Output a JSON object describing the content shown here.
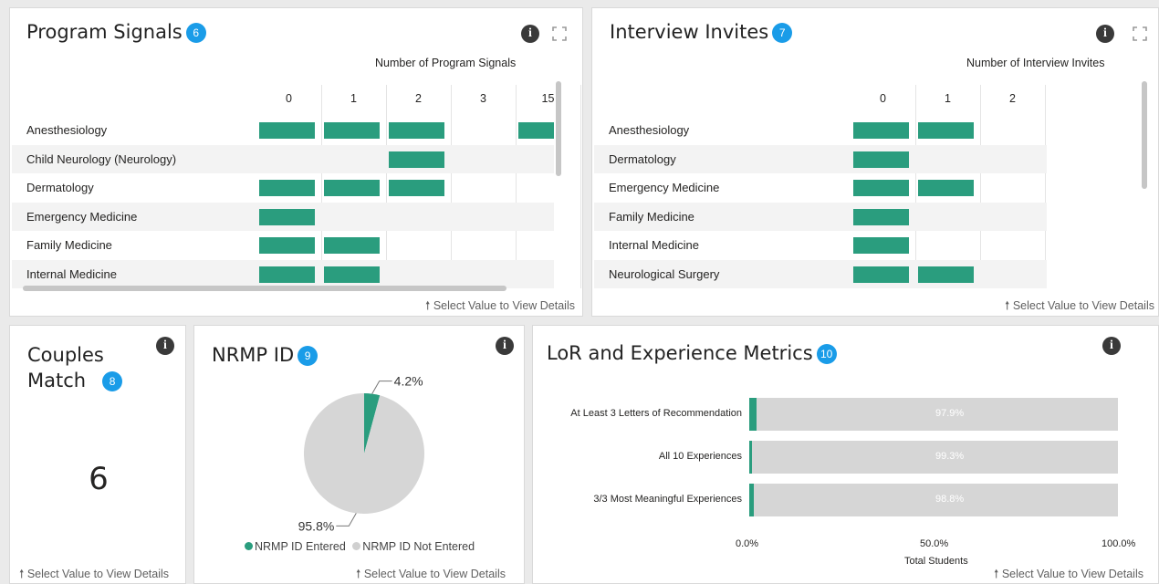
{
  "program_signals": {
    "title": "Program Signals",
    "badge": "6",
    "axis_title": "Number of Program Signals",
    "columns": [
      "0",
      "1",
      "2",
      "3",
      "15"
    ],
    "rows": [
      {
        "label": "Anesthesiology",
        "cells": [
          true,
          true,
          true,
          false,
          true
        ]
      },
      {
        "label": "Child Neurology (Neurology)",
        "cells": [
          false,
          false,
          true,
          false,
          false
        ]
      },
      {
        "label": "Dermatology",
        "cells": [
          true,
          true,
          true,
          false,
          false
        ]
      },
      {
        "label": "Emergency Medicine",
        "cells": [
          true,
          false,
          false,
          false,
          false
        ]
      },
      {
        "label": "Family Medicine",
        "cells": [
          true,
          true,
          false,
          false,
          false
        ]
      },
      {
        "label": "Internal Medicine",
        "cells": [
          true,
          true,
          false,
          false,
          false
        ]
      }
    ],
    "footer": "Select Value to View Details"
  },
  "interview_invites": {
    "title": "Interview Invites",
    "badge": "7",
    "axis_title": "Number of Interview Invites",
    "columns": [
      "0",
      "1",
      "2"
    ],
    "rows": [
      {
        "label": "Anesthesiology",
        "cells": [
          true,
          true,
          false
        ]
      },
      {
        "label": "Dermatology",
        "cells": [
          true,
          false,
          false
        ]
      },
      {
        "label": "Emergency Medicine",
        "cells": [
          true,
          true,
          false
        ]
      },
      {
        "label": "Family Medicine",
        "cells": [
          true,
          false,
          false
        ]
      },
      {
        "label": "Internal Medicine",
        "cells": [
          true,
          false,
          false
        ]
      },
      {
        "label": "Neurological Surgery",
        "cells": [
          true,
          true,
          false
        ]
      }
    ],
    "footer": "Select Value to View Details"
  },
  "couples_match": {
    "title_line1": "Couples",
    "title_line2": "Match",
    "badge": "8",
    "value": "6",
    "footer": "Select Value to View Details"
  },
  "nrmp_id": {
    "title": "NRMP ID",
    "badge": "9",
    "footer": "Select Value to View Details",
    "legend": [
      {
        "label": "NRMP ID Entered",
        "color": "#2a9d7e"
      },
      {
        "label": "NRMP ID Not Entered",
        "color": "#d6d6d6"
      }
    ]
  },
  "lor": {
    "title": "LoR and Experience Metrics",
    "badge": "10",
    "footer": "Select Value to View Details"
  },
  "icons": {
    "info": "i"
  },
  "chart_data": [
    {
      "type": "pie",
      "labels": [
        "NRMP ID Entered",
        "NRMP ID Not Entered"
      ],
      "values": [
        4.2,
        95.8
      ],
      "value_labels": [
        "4.2%",
        "95.8%"
      ],
      "colors": [
        "#2a9d7e",
        "#d6d6d6"
      ]
    },
    {
      "type": "bar",
      "orientation": "horizontal",
      "stacked": true,
      "categories": [
        "At Least 3 Letters of Recommendation",
        "All 10 Experiences",
        "3/3 Most Meaningful Experiences"
      ],
      "series": [
        {
          "values": [
            2.1,
            0.7,
            1.2
          ],
          "color": "#2a9d7e"
        },
        {
          "values": [
            97.9,
            99.3,
            98.8
          ],
          "color": "#d6d6d6",
          "labels": [
            "97.9%",
            "99.3%",
            "98.8%"
          ]
        }
      ],
      "xlabel": "Total Students",
      "xticks": [
        "0.0%",
        "50.0%",
        "100.0%"
      ],
      "xlim": [
        0,
        100
      ]
    }
  ]
}
